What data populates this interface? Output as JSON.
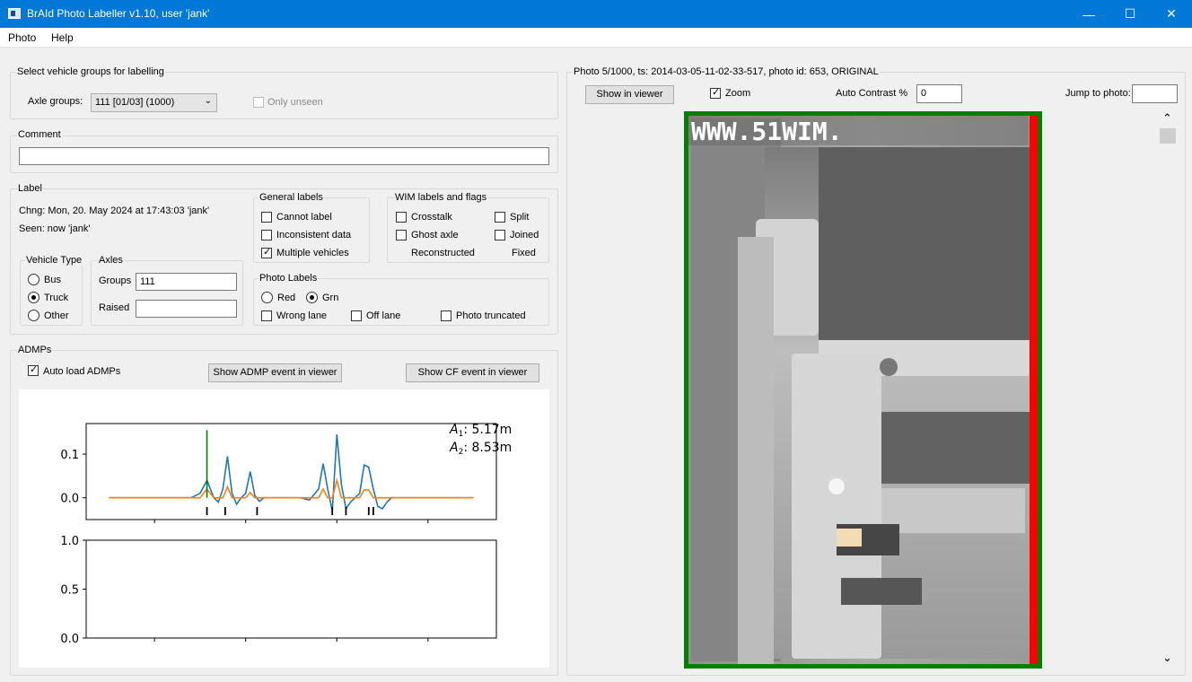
{
  "window": {
    "title": "BrAId Photo Labeller v1.10, user 'jank'",
    "minimize_glyph": "—",
    "maximize_glyph": "☐",
    "close_glyph": "✕"
  },
  "menu": [
    "Photo",
    "Help"
  ],
  "groups_box": {
    "title": "Select vehicle groups for labelling",
    "axle_groups_label": "Axle groups:",
    "axle_groups_value": "111 [01/03] (1000)",
    "only_unseen_label": "Only unseen",
    "only_unseen_checked": false
  },
  "comment_box": {
    "title": "Comment",
    "value": ""
  },
  "label_box": {
    "title": "Label",
    "chng": "Chng: Mon, 20. May 2024 at 17:43:03 'jank'",
    "seen": "Seen: now 'jank'",
    "vehicle_type": {
      "title": "Vehicle Type",
      "options": [
        "Bus",
        "Truck",
        "Other"
      ],
      "selected": "Truck"
    },
    "axles": {
      "title": "Axles",
      "groups_label": "Groups",
      "groups_value": "111",
      "raised_label": "Raised",
      "raised_value": ""
    },
    "general_labels": {
      "title": "General labels",
      "items": [
        {
          "label": "Cannot label",
          "checked": false
        },
        {
          "label": "Inconsistent data",
          "checked": false
        },
        {
          "label": "Multiple vehicles",
          "checked": true
        }
      ]
    },
    "wim_labels": {
      "title": "WIM labels and flags",
      "crosstalk": "Crosstalk",
      "split": "Split",
      "ghost_axle": "Ghost axle",
      "joined": "Joined",
      "reconstructed": "Reconstructed",
      "fixed": "Fixed"
    },
    "photo_labels": {
      "title": "Photo Labels",
      "red": "Red",
      "grn": "Grn",
      "selected": "Grn",
      "wrong_lane": "Wrong lane",
      "off_lane": "Off lane",
      "photo_truncated": "Photo truncated"
    }
  },
  "admps_box": {
    "title": "ADMPs",
    "auto_load_label": "Auto load ADMPs",
    "auto_load_checked": true,
    "show_admp_button": "Show ADMP event in viewer",
    "show_cf_button": "Show CF event in viewer"
  },
  "plot_annotations": {
    "a1_sym": "A",
    "a1_sub": "1",
    "a1_value": ":  5.17m",
    "a2_sym": "A",
    "a2_sub": "2",
    "a2_value": ":  8.53m"
  },
  "chart_data": [
    {
      "type": "line",
      "ylim": [
        -0.05,
        0.17
      ],
      "y_ticks": [
        "0.1",
        "0.0"
      ],
      "y_tick_values": [
        0.1,
        0.0
      ],
      "series": [
        {
          "color": "#1f77b4",
          "x": [
            0,
            18,
            20,
            21.5,
            23,
            24,
            25,
            26,
            27,
            28,
            29,
            30,
            31,
            32,
            33,
            34,
            35,
            36,
            37,
            42,
            44,
            46,
            47,
            48,
            49,
            50,
            51,
            52,
            53,
            54,
            55,
            56,
            57,
            58,
            59,
            60,
            61,
            62,
            63,
            64,
            65,
            66,
            67,
            68,
            69,
            70,
            71,
            72,
            73,
            80
          ],
          "y": [
            0,
            0,
            0.01,
            0.04,
            0,
            -0.01,
            0.02,
            0.095,
            0.01,
            -0.015,
            0,
            0.01,
            0.06,
            0.005,
            -0.008,
            0,
            0,
            0,
            0,
            0,
            -0.005,
            0.02,
            0.078,
            0.02,
            -0.03,
            0.145,
            0.03,
            -0.025,
            -0.01,
            0,
            0.01,
            0.075,
            0.07,
            0.02,
            -0.02,
            -0.025,
            -0.01,
            0,
            0,
            0,
            0,
            0,
            0,
            0,
            0,
            0,
            0,
            0,
            0,
            0
          ]
        },
        {
          "color": "#ff7f0e",
          "x": [
            0,
            20,
            21.5,
            23,
            25,
            26,
            27,
            30,
            31,
            32,
            46,
            47,
            48,
            49,
            50,
            51,
            55,
            56,
            57,
            58,
            80
          ],
          "y": [
            0,
            0,
            0.02,
            0,
            0,
            0.025,
            0,
            0,
            0.012,
            0,
            0,
            0.02,
            0,
            0,
            0.04,
            0,
            0,
            0.018,
            0.018,
            0,
            0
          ]
        }
      ],
      "marker_lines": [
        {
          "x": 21.5,
          "color": "#008000",
          "y_top": 0.155
        }
      ],
      "axle_ticks_x": [
        21.5,
        25.5,
        32.5,
        49,
        52,
        57,
        58
      ]
    },
    {
      "type": "line",
      "ylim": [
        0.0,
        1.0
      ],
      "y_ticks": [
        "1.0",
        "0.5",
        "0.0"
      ],
      "y_tick_values": [
        1.0,
        0.5,
        0.0
      ],
      "series": []
    }
  ],
  "right_panel": {
    "header": "Photo 5/1000, ts: 2014-03-05-11-02-33-517, photo id: 653, ORIGINAL",
    "show_in_viewer": "Show in viewer",
    "zoom_label": "Zoom",
    "zoom_checked": true,
    "auto_contrast_label": "Auto Contrast %",
    "auto_contrast_value": "0",
    "jump_label": "Jump to photo:",
    "jump_value": "",
    "photo_overlay_text": "WWW.51WIM.",
    "scroll_up": "⌃",
    "scroll_down": "⌄"
  },
  "colors": {
    "titlebar": "#0078d7",
    "photo_border_green": "#008000",
    "photo_border_red": "#ff0000"
  }
}
